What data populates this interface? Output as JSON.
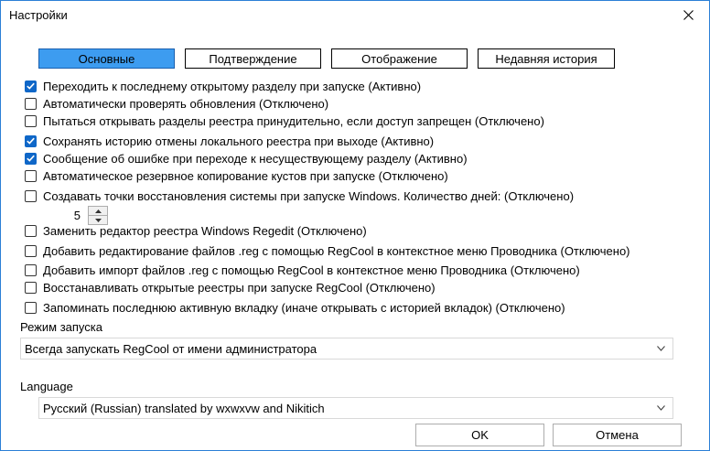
{
  "window": {
    "title": "Настройки"
  },
  "tabs": [
    {
      "label": "Основные",
      "active": true
    },
    {
      "label": "Подтверждение",
      "active": false
    },
    {
      "label": "Отображение",
      "active": false
    },
    {
      "label": "Недавняя история",
      "active": false
    }
  ],
  "options": [
    {
      "label": "Переходить к последнему открытому разделу при запуске (Активно)",
      "checked": true
    },
    {
      "label": "Автоматически проверять обновления (Отключено)",
      "checked": false
    },
    {
      "label": "Пытаться открывать разделы реестра принудительно, если доступ запрещен (Отключено)",
      "checked": false
    },
    {
      "label": "Сохранять историю отмены локального реестра при выходе (Активно)",
      "checked": true
    },
    {
      "label": "Сообщение об ошибке при переходе к несуществующему разделу (Активно)",
      "checked": true
    },
    {
      "label": "Автоматическое резервное копирование кустов при запуске (Отключено)",
      "checked": false
    },
    {
      "label": "Создавать точки восстановления системы при запуске Windows. Количество дней: (Отключено)",
      "checked": false
    },
    {
      "label": "Заменить редактор реестра Windows Regedit (Отключено)",
      "checked": false
    },
    {
      "label": "Добавить редактирование файлов .reg с помощью RegCool в контекстное меню Проводника (Отключено)",
      "checked": false
    },
    {
      "label": "Добавить импорт файлов .reg с помощью RegCool в контекстное меню Проводника (Отключено)",
      "checked": false
    },
    {
      "label": "Восстанавливать открытые реестры при запуске RegCool (Отключено)",
      "checked": false
    },
    {
      "label": "Запоминать последнюю активную вкладку (иначе открывать с историей вкладок) (Отключено)",
      "checked": false
    }
  ],
  "days_spinner": {
    "value": "5"
  },
  "launch_mode": {
    "label": "Режим запуска",
    "selected": "Всегда запускать RegCool от имени администратора"
  },
  "language": {
    "label": "Language",
    "selected": "Русский (Russian) translated by wxwxvw and Nikitich"
  },
  "buttons": {
    "ok": "OK",
    "cancel": "Отмена"
  },
  "colors": {
    "accent": "#0f67c8",
    "active_tab": "#3d9cf0",
    "window_border": "#2b7fd6"
  }
}
